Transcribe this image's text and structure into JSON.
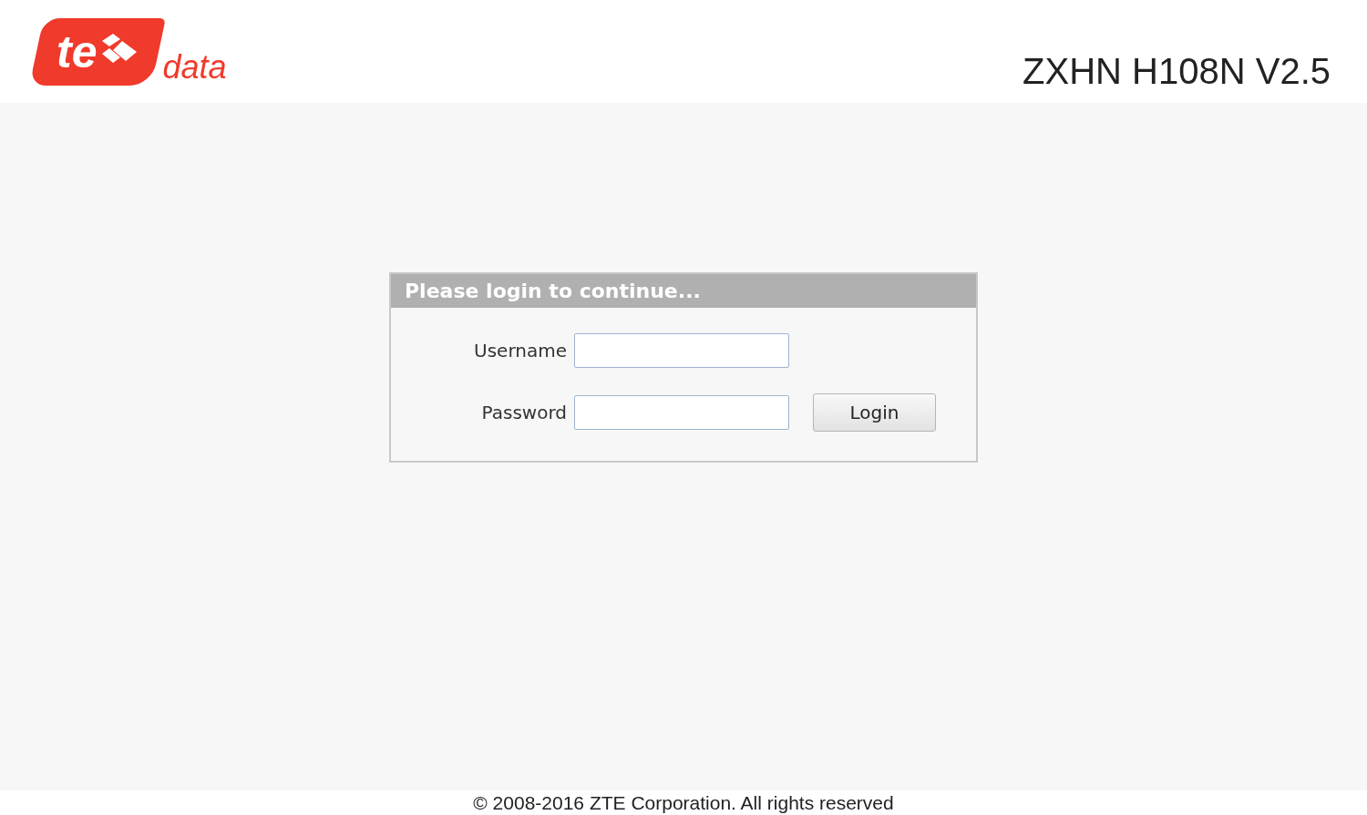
{
  "header": {
    "logo": {
      "mark": "te",
      "word": "data"
    },
    "model": "ZXHN H108N V2.5"
  },
  "login": {
    "title": "Please login to continue...",
    "fields": [
      {
        "label": "Username"
      },
      {
        "label": "Password"
      }
    ],
    "button": "Login"
  },
  "footer": "© 2008-2016 ZTE Corporation. All rights reserved"
}
